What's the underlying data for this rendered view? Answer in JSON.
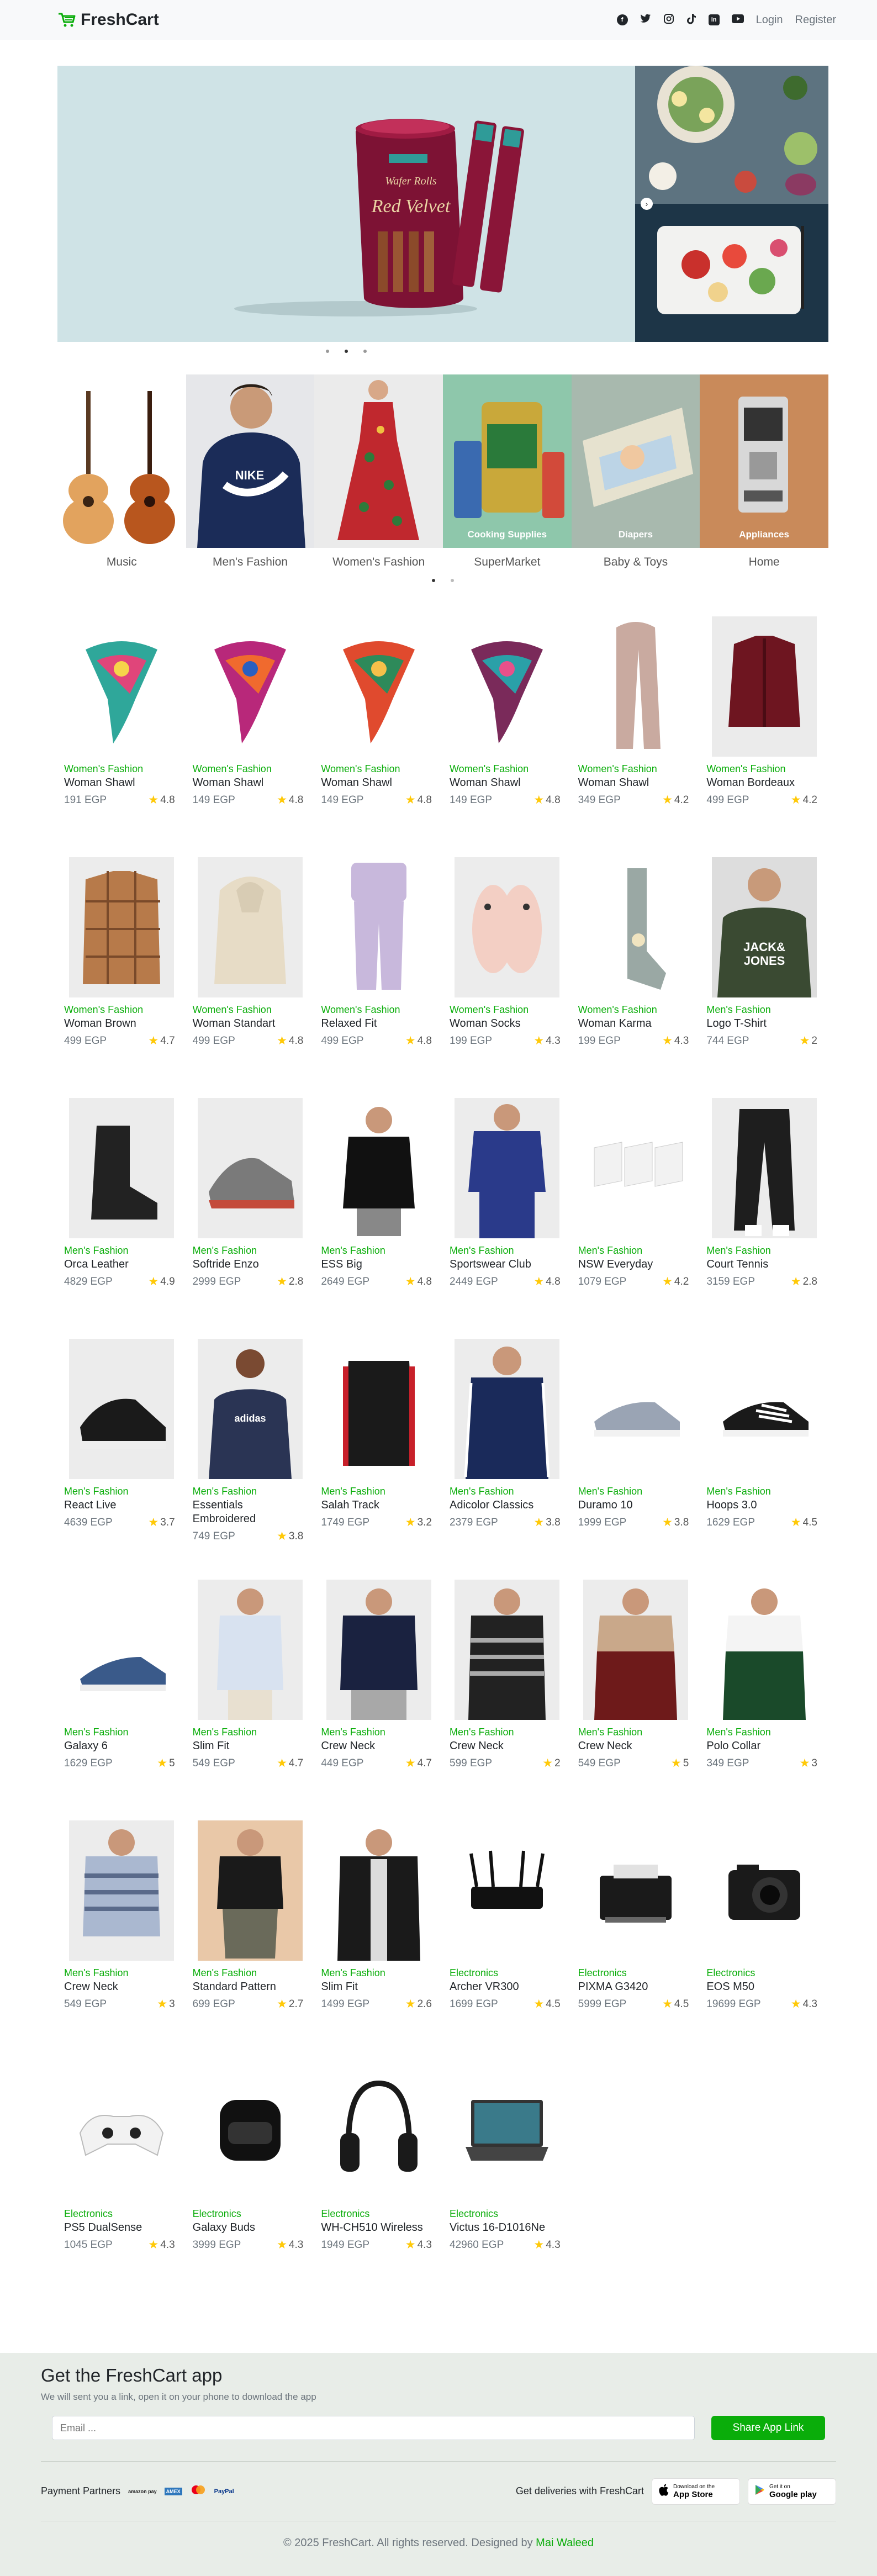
{
  "navbar": {
    "brand": "FreshCart",
    "social": [
      "facebook-icon",
      "twitter-icon",
      "instagram-icon",
      "tiktok-icon",
      "linkedin-icon",
      "youtube-icon"
    ],
    "login": "Login",
    "register": "Register"
  },
  "slider": {
    "product_brand": "Red Velvet",
    "product_subtitle": "Wafer Rolls"
  },
  "categories": [
    {
      "name": "Music"
    },
    {
      "name": "Men's Fashion"
    },
    {
      "name": "Women's Fashion"
    },
    {
      "name": "SuperMarket",
      "overlay": "Cooking Supplies"
    },
    {
      "name": "Baby & Toys",
      "overlay": "Diapers"
    },
    {
      "name": "Home",
      "overlay": "Appliances"
    }
  ],
  "products": [
    {
      "category": "Women's Fashion",
      "title": "Woman Shawl",
      "price": "191 EGP",
      "rating": "4.8"
    },
    {
      "category": "Women's Fashion",
      "title": "Woman Shawl",
      "price": "149 EGP",
      "rating": "4.8"
    },
    {
      "category": "Women's Fashion",
      "title": "Woman Shawl",
      "price": "149 EGP",
      "rating": "4.8"
    },
    {
      "category": "Women's Fashion",
      "title": "Woman Shawl",
      "price": "149 EGP",
      "rating": "4.8"
    },
    {
      "category": "Women's Fashion",
      "title": "Woman Shawl",
      "price": "349 EGP",
      "rating": "4.2"
    },
    {
      "category": "Women's Fashion",
      "title": "Woman Bordeaux",
      "price": "499 EGP",
      "rating": "4.2"
    },
    {
      "category": "Women's Fashion",
      "title": "Woman Brown",
      "price": "499 EGP",
      "rating": "4.7"
    },
    {
      "category": "Women's Fashion",
      "title": "Woman Standart",
      "price": "499 EGP",
      "rating": "4.8"
    },
    {
      "category": "Women's Fashion",
      "title": "Relaxed Fit",
      "price": "499 EGP",
      "rating": "4.8"
    },
    {
      "category": "Women's Fashion",
      "title": "Woman Socks",
      "price": "199 EGP",
      "rating": "4.3"
    },
    {
      "category": "Women's Fashion",
      "title": "Woman Karma",
      "price": "199 EGP",
      "rating": "4.3"
    },
    {
      "category": "Men's Fashion",
      "title": "Logo T-Shirt",
      "price": "744 EGP",
      "rating": "2"
    },
    {
      "category": "Men's Fashion",
      "title": "Orca Leather",
      "price": "4829 EGP",
      "rating": "4.9"
    },
    {
      "category": "Men's Fashion",
      "title": "Softride Enzo",
      "price": "2999 EGP",
      "rating": "2.8"
    },
    {
      "category": "Men's Fashion",
      "title": "ESS Big",
      "price": "2649 EGP",
      "rating": "4.8"
    },
    {
      "category": "Men's Fashion",
      "title": "Sportswear Club",
      "price": "2449 EGP",
      "rating": "4.8"
    },
    {
      "category": "Men's Fashion",
      "title": "NSW Everyday",
      "price": "1079 EGP",
      "rating": "4.2"
    },
    {
      "category": "Men's Fashion",
      "title": "Court Tennis",
      "price": "3159 EGP",
      "rating": "2.8"
    },
    {
      "category": "Men's Fashion",
      "title": "React Live",
      "price": "4639 EGP",
      "rating": "3.7"
    },
    {
      "category": "Men's Fashion",
      "title": "Essentials Embroidered",
      "price": "749 EGP",
      "rating": "3.8"
    },
    {
      "category": "Men's Fashion",
      "title": "Salah Track",
      "price": "1749 EGP",
      "rating": "3.2"
    },
    {
      "category": "Men's Fashion",
      "title": "Adicolor Classics",
      "price": "2379 EGP",
      "rating": "3.8"
    },
    {
      "category": "Men's Fashion",
      "title": "Duramo 10",
      "price": "1999 EGP",
      "rating": "3.8"
    },
    {
      "category": "Men's Fashion",
      "title": "Hoops 3.0",
      "price": "1629 EGP",
      "rating": "4.5"
    },
    {
      "category": "Men's Fashion",
      "title": "Galaxy 6",
      "price": "1629 EGP",
      "rating": "5"
    },
    {
      "category": "Men's Fashion",
      "title": "Slim Fit",
      "price": "549 EGP",
      "rating": "4.7"
    },
    {
      "category": "Men's Fashion",
      "title": "Crew Neck",
      "price": "449 EGP",
      "rating": "4.7"
    },
    {
      "category": "Men's Fashion",
      "title": "Crew Neck",
      "price": "599 EGP",
      "rating": "2"
    },
    {
      "category": "Men's Fashion",
      "title": "Crew Neck",
      "price": "549 EGP",
      "rating": "5"
    },
    {
      "category": "Men's Fashion",
      "title": "Polo Collar",
      "price": "349 EGP",
      "rating": "3"
    },
    {
      "category": "Men's Fashion",
      "title": "Crew Neck",
      "price": "549 EGP",
      "rating": "3"
    },
    {
      "category": "Men's Fashion",
      "title": "Standard Pattern",
      "price": "699 EGP",
      "rating": "2.7"
    },
    {
      "category": "Men's Fashion",
      "title": "Slim Fit",
      "price": "1499 EGP",
      "rating": "2.6"
    },
    {
      "category": "Electronics",
      "title": "Archer VR300",
      "price": "1699 EGP",
      "rating": "4.5"
    },
    {
      "category": "Electronics",
      "title": "PIXMA G3420",
      "price": "5999 EGP",
      "rating": "4.5"
    },
    {
      "category": "Electronics",
      "title": "EOS M50",
      "price": "19699 EGP",
      "rating": "4.3"
    },
    {
      "category": "Electronics",
      "title": "PS5 DualSense",
      "price": "1045 EGP",
      "rating": "4.3"
    },
    {
      "category": "Electronics",
      "title": "Galaxy Buds",
      "price": "3999 EGP",
      "rating": "4.3"
    },
    {
      "category": "Electronics",
      "title": "WH-CH510 Wireless",
      "price": "1949 EGP",
      "rating": "4.3"
    },
    {
      "category": "Electronics",
      "title": "Victus 16-D1016Ne",
      "price": "42960 EGP",
      "rating": "4.3"
    }
  ],
  "footer": {
    "title": "Get the FreshCart app",
    "subtitle": "We will sent you a link, open it on your phone to download the app",
    "email_placeholder": "Email ...",
    "share_button": "Share App Link",
    "partners_label": "Payment Partners",
    "partners": [
      "amazon pay",
      "AMEX",
      "mastercard",
      "PayPal"
    ],
    "deliveries_label": "Get deliveries with FreshCart",
    "app_store_small": "Download on the",
    "app_store_big": "App Store",
    "google_small": "Get it on",
    "google_big": "Google play",
    "copyright": "© 2025 FreshCart. All rights reserved. Designed by",
    "author": "Mai Waleed"
  },
  "colors": {
    "accent": "#0aad0a",
    "star": "#ffc908",
    "navbar_bg": "#f8f9fa",
    "footer_bg": "#e8ede8"
  }
}
